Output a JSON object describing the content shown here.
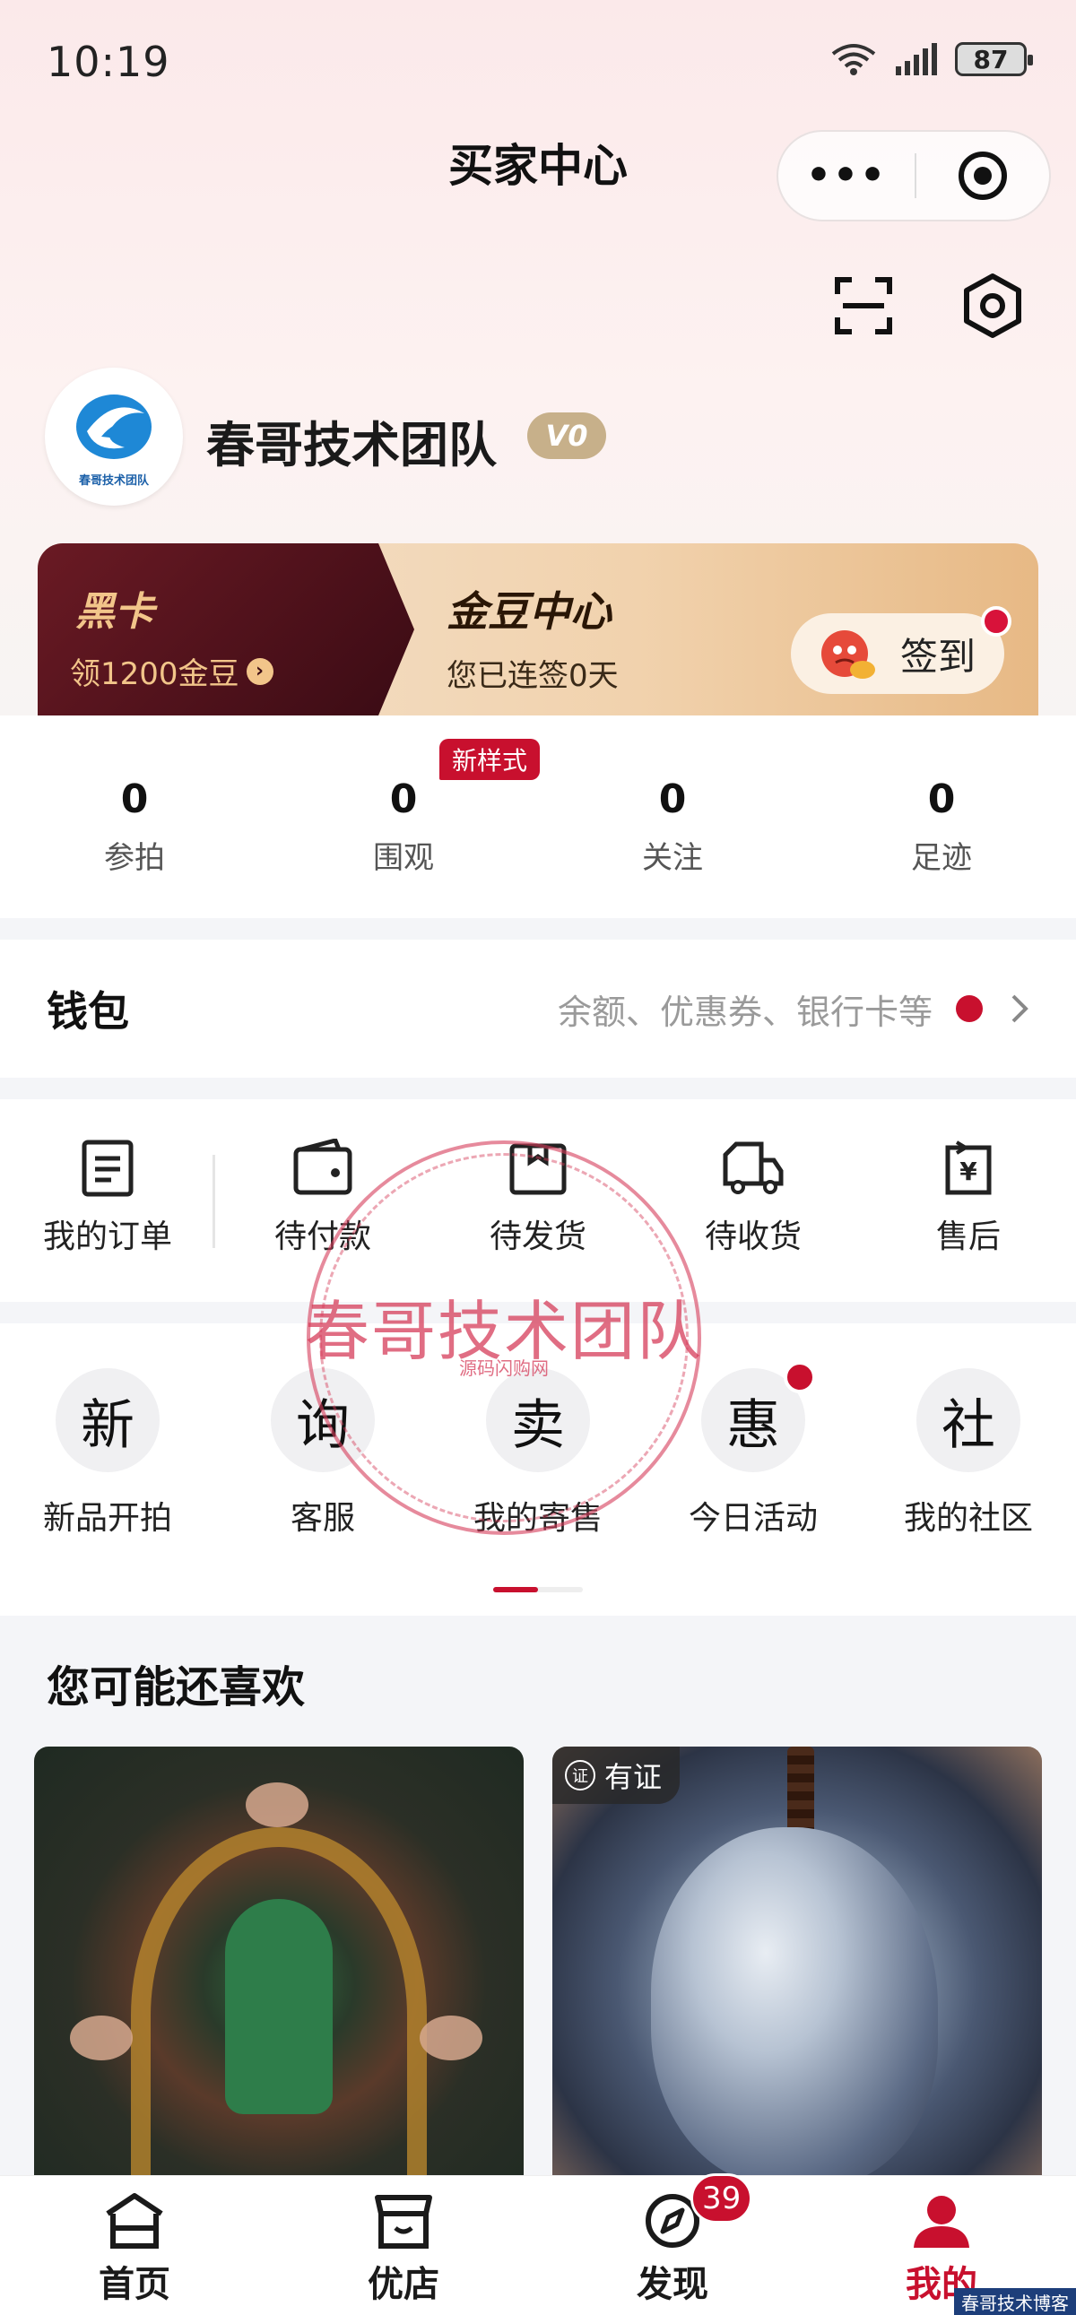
{
  "status_bar": {
    "time": "10:19",
    "battery": "87"
  },
  "nav": {
    "title": "买家中心",
    "more_label": "•••"
  },
  "profile": {
    "name": "春哥技术团队",
    "level": "V0",
    "avatar_text": "春哥技术团队"
  },
  "banner": {
    "black_card_title": "黑卡",
    "black_card_sub": "领1200金豆",
    "gold_title": "金豆中心",
    "gold_sub": "您已连签0天",
    "signin_label": "签到"
  },
  "stats": {
    "badge": "新样式",
    "items": [
      {
        "num": "0",
        "label": "参拍"
      },
      {
        "num": "0",
        "label": "围观"
      },
      {
        "num": "0",
        "label": "关注"
      },
      {
        "num": "0",
        "label": "足迹"
      }
    ]
  },
  "wallet": {
    "title": "钱包",
    "desc": "余额、优惠券、银行卡等"
  },
  "orders": [
    {
      "label": "我的订单",
      "icon": "order-list-icon"
    },
    {
      "label": "待付款",
      "icon": "wallet-icon"
    },
    {
      "label": "待发货",
      "icon": "box-icon"
    },
    {
      "label": "待收货",
      "icon": "truck-icon"
    },
    {
      "label": "售后",
      "icon": "refund-icon"
    }
  ],
  "services": [
    {
      "glyph": "新",
      "label": "新品开拍"
    },
    {
      "glyph": "询",
      "label": "客服"
    },
    {
      "glyph": "卖",
      "label": "我的寄售"
    },
    {
      "glyph": "惠",
      "label": "今日活动"
    },
    {
      "glyph": "社",
      "label": "我的社区"
    }
  ],
  "watermark": {
    "text": "春哥技术团队",
    "sub": "源码闪购网"
  },
  "recommend": {
    "title": "您可能还喜欢",
    "cert_label": "有证",
    "cert_icon_char": "证"
  },
  "tabbar": {
    "items": [
      {
        "label": "首页"
      },
      {
        "label": "优店"
      },
      {
        "label": "发现"
      },
      {
        "label": "我的"
      }
    ],
    "discover_badge": "39"
  },
  "corner_watermark": "春哥技术博客",
  "colors": {
    "accent": "#c8102e",
    "gold": "#f2c58a",
    "level_badge": "#c7b08a"
  }
}
